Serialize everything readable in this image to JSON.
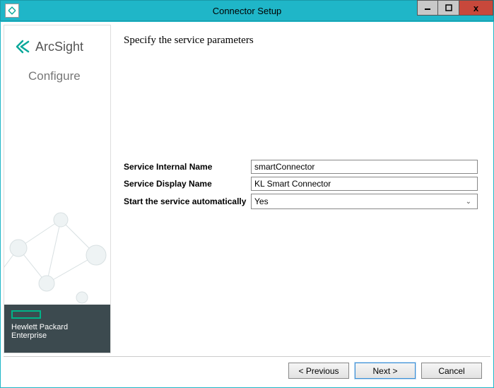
{
  "window": {
    "title": "Connector Setup"
  },
  "sidebar": {
    "brand": "ArcSight",
    "subtitle": "Configure",
    "footer_line1": "Hewlett Packard",
    "footer_line2": "Enterprise"
  },
  "main": {
    "heading": "Specify the service parameters",
    "fields": {
      "internal_name_label": "Service Internal Name",
      "internal_name_value": "smartConnector",
      "display_name_label": "Service Display Name",
      "display_name_value": "KL Smart Connector",
      "auto_start_label": "Start the service automatically",
      "auto_start_value": "Yes"
    }
  },
  "buttons": {
    "previous": "< Previous",
    "next": "Next >",
    "cancel": "Cancel"
  }
}
